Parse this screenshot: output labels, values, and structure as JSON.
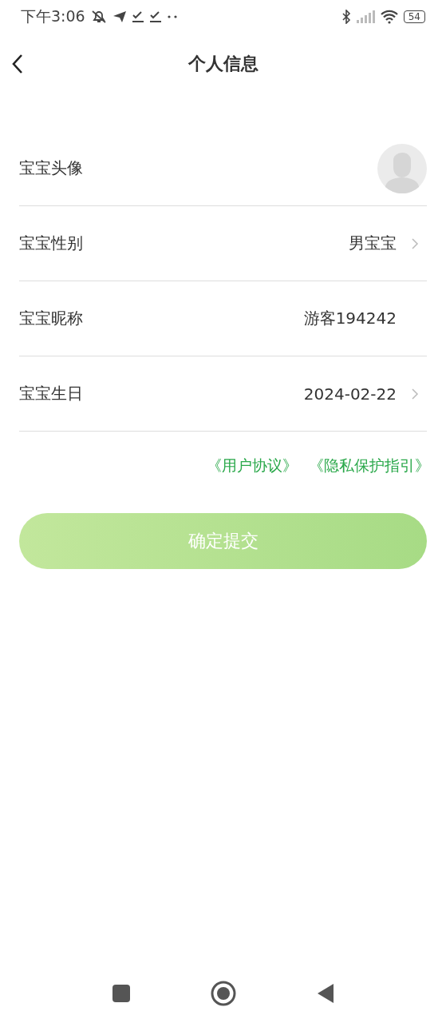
{
  "status_bar": {
    "time": "下午3:06",
    "battery": "54"
  },
  "header": {
    "title": "个人信息"
  },
  "rows": [
    {
      "kind": "avatar",
      "label": "宝宝头像"
    },
    {
      "kind": "value",
      "label": "宝宝性别",
      "value": "男宝宝",
      "chevron": true
    },
    {
      "kind": "value",
      "label": "宝宝昵称",
      "value": "游客194242",
      "chevron": false
    },
    {
      "kind": "value",
      "label": "宝宝生日",
      "value": "2024-02-22",
      "chevron": true
    }
  ],
  "links": [
    "《用户协议》",
    "《隐私保护指引》"
  ],
  "submit": {
    "label": "确定提交",
    "disabled": true
  }
}
